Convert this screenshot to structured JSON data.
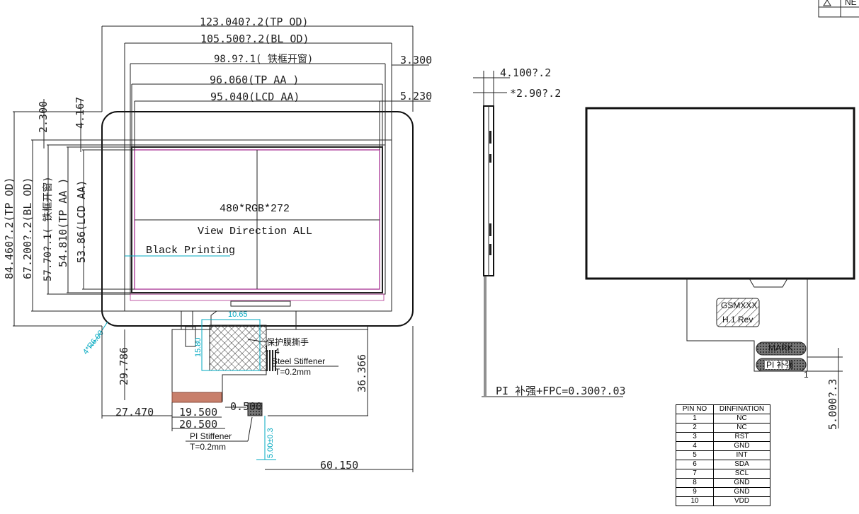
{
  "front": {
    "tp_od_w": "123.040?.2(TP OD)",
    "bl_od_w": "105.500?.2(BL OD)",
    "frame_w": "98.9?.1( 铁框开窗)",
    "tp_aa_w": "96.060(TP AA )",
    "lcd_aa_w": "95.040(LCD AA)",
    "off_top_1": "3.300",
    "off_top_2": "5.230",
    "v_2300": "2.300",
    "v_4167": "4.167",
    "tp_od_h": "84.460?.2(TP OD)",
    "bl_od_h": "67.200?.2(BL OD)",
    "frame_h": "57.70?.1( 铁框开窗)",
    "tp_aa_h": "54.810(TP AA )",
    "lcd_aa_h": "53.86(LCD AA)",
    "resolution": "480*RGB*272",
    "view_direction": "View Direction ALL",
    "black_printing": "Black Printing",
    "corner_radius": "4*R6.00",
    "tab_w": "10.65",
    "tab_h": "15.80",
    "peel_tab": "保护膜撕手",
    "pin_1": "1",
    "pin_4": "4",
    "steel_stiffener": "Steel Stiffener",
    "steel_t": "T=0.2mm",
    "d_29786": "29.786",
    "d_36366": "36.366",
    "d_27470": "27.470",
    "d_19500": "19.500",
    "d_20500": "20.500",
    "d_0500": "0.500",
    "pi_stiffener": "PI Stiffener",
    "pi_t": "T=0.2mm",
    "d_5003": "5.00±0.3",
    "d_60150": "60.150"
  },
  "side": {
    "total_t": "4.100?.2",
    "lcd_t": "*2.90?.2",
    "fpc_note": "PI 补强+FPC=0.300?.03"
  },
  "back": {
    "chip_line1": "GSMXXX",
    "chip_line2": "H.1 Rev",
    "label_top": "MARK",
    "label_pi": "PI 补强",
    "pin1": "1",
    "fpc_len": "5.000?.3"
  },
  "corner_label": "NE",
  "pin_table": {
    "headers": [
      "PIN NO",
      "DINFINATION"
    ],
    "rows": [
      [
        "1",
        "NC"
      ],
      [
        "2",
        "NC"
      ],
      [
        "3",
        "RST"
      ],
      [
        "4",
        "GND"
      ],
      [
        "5",
        "INT"
      ],
      [
        "6",
        "SDA"
      ],
      [
        "7",
        "SCL"
      ],
      [
        "8",
        "GND"
      ],
      [
        "9",
        "GND"
      ],
      [
        "10",
        "VDD"
      ]
    ]
  }
}
